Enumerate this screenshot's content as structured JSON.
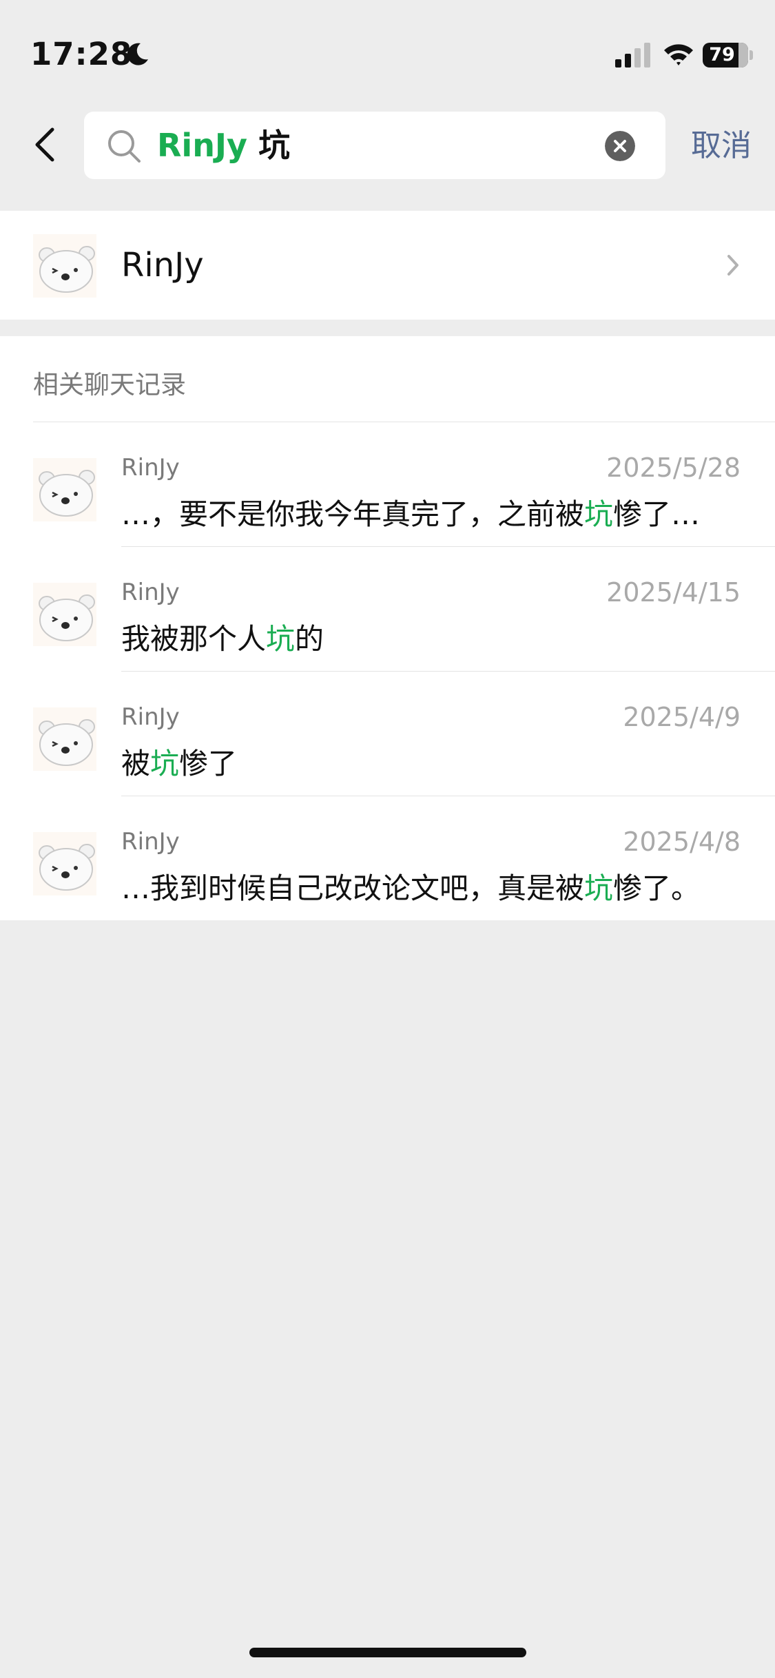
{
  "status_bar": {
    "time": "17:28",
    "battery": "79"
  },
  "search": {
    "query_name": "RinJy",
    "query_term": "坑",
    "cancel_label": "取消"
  },
  "contact": {
    "name": "RinJy"
  },
  "records": {
    "section_title": "相关聊天记录",
    "items": [
      {
        "sender": "RinJy",
        "date": "2025/5/28",
        "before": "…，要不是你我今年真完了，之前被",
        "highlight": "坑",
        "after": "惨了…"
      },
      {
        "sender": "RinJy",
        "date": "2025/4/15",
        "before": "我被那个人",
        "highlight": "坑",
        "after": "的"
      },
      {
        "sender": "RinJy",
        "date": "2025/4/9",
        "before": "被",
        "highlight": "坑",
        "after": "惨了"
      },
      {
        "sender": "RinJy",
        "date": "2025/4/8",
        "before": "…我到时候自己改改论文吧，真是被",
        "highlight": "坑",
        "after": "惨了。"
      }
    ]
  },
  "colors": {
    "highlight": "#1aad52",
    "link_blue": "#576b95",
    "page_background": "#ededed"
  }
}
